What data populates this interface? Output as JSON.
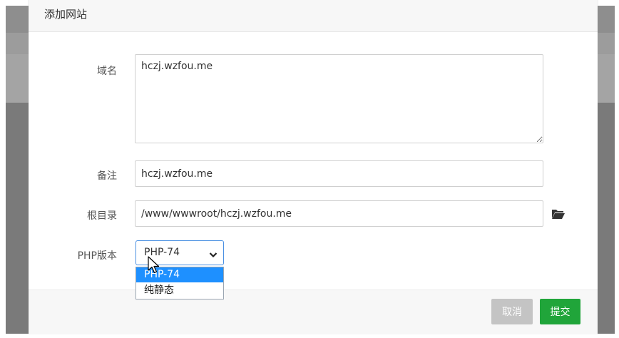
{
  "modal": {
    "title": "添加网站"
  },
  "form": {
    "domain": {
      "label": "域名",
      "value": "hczj.wzfou.me"
    },
    "remark": {
      "label": "备注",
      "value": "hczj.wzfou.me"
    },
    "root": {
      "label": "根目录",
      "value": "/www/wwwroot/hczj.wzfou.me",
      "icon": "folder-open-icon"
    },
    "php": {
      "label": "PHP版本",
      "selected": "PHP-74",
      "options": [
        "PHP-74",
        "纯静态"
      ],
      "highlighted_option": "PHP-74"
    }
  },
  "footer": {
    "cancel_label": "取消",
    "submit_label": "提交"
  },
  "colors": {
    "submit": "#20a53a",
    "cancel": "#c4c4c4",
    "option_highlight": "#1e90ff",
    "select_border": "#4a90e2"
  }
}
